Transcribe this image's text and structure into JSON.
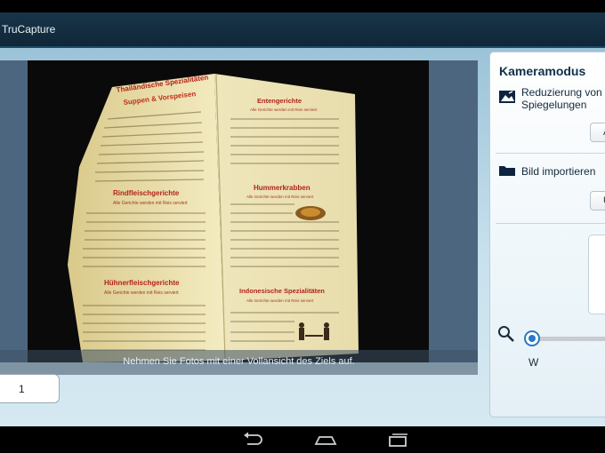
{
  "app": {
    "title": "TruCapture"
  },
  "preview": {
    "hint": "Nehmen Sie Fotos mit einer Vollansicht des Ziels auf."
  },
  "page_field": {
    "value": "1"
  },
  "side_panel": {
    "title": "Kameramodus",
    "reflection": {
      "label": "Reduzierung von Spiegelungen",
      "button": "A",
      "icon": "reflection-icon"
    },
    "import": {
      "label": "Bild importieren",
      "button": "U",
      "icon": "folder-icon"
    },
    "zoom": {
      "icon": "magnifier-icon",
      "label": "W",
      "level": 0
    }
  },
  "menu_photo": {
    "left_page": {
      "heading": "Thailändische Spezialitäten",
      "sub1": "Suppen & Vorspeisen",
      "sec2": "Rindfleischgerichte",
      "sec2_note": "Alle Gerichte werden mit Reis serviert",
      "sec3": "Hühnerfleischgerichte",
      "sec3_note": "Alle Gerichte werden mit Reis serviert"
    },
    "right_page": {
      "sec1": "Entengerichte",
      "sec1_note": "Alle Gerichte werden mit Reis serviert",
      "sec2": "Hummerkrabben",
      "sec2_note": "Alle Gerichte werden mit Reis serviert",
      "sec3": "Indonesische Spezialitäten",
      "sec3_note": "Alle Gerichte werden mit Reis serviert"
    }
  },
  "colors": {
    "title_bar": "#183549",
    "accent": "#2b78c5",
    "panel_text": "#10304a"
  }
}
